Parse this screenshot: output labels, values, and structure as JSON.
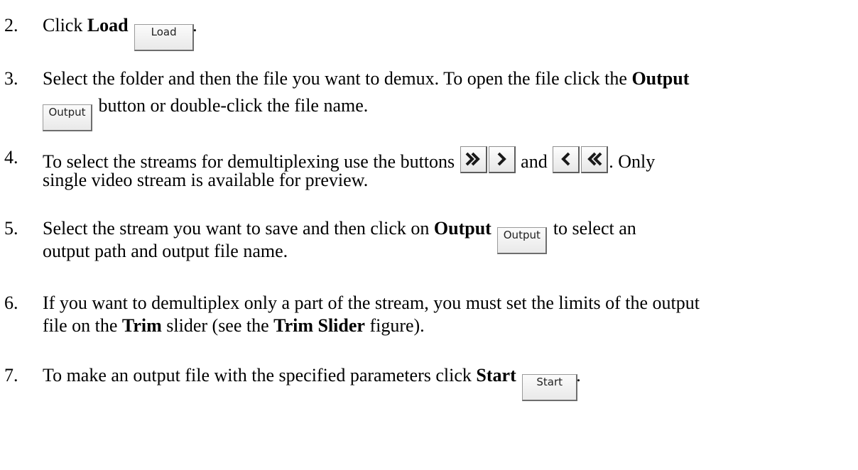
{
  "steps": [
    {
      "number": "2.",
      "line1_pre": "Click ",
      "line1_bold": "Load",
      "button_label": "Load",
      "line1_post": "."
    },
    {
      "number": "3.",
      "line1_pre": "Select the folder and then the file you want to demux. To open the file click the ",
      "line1_bold": "Output",
      "button_label": "Output",
      "line2_post": " button or double-click the file name."
    },
    {
      "number": "4.",
      "line1_pre": "To select the streams for demultiplexing use the buttons ",
      "line1_mid": " and ",
      "line1_post": ". Only",
      "line2": "single video stream is available for preview.",
      "icons": [
        "double-right-arrow-icon",
        "right-arrow-icon",
        "left-arrow-icon",
        "double-left-arrow-icon"
      ]
    },
    {
      "number": "5.",
      "line1_pre": "Select the stream you want to save and then click on ",
      "line1_bold": "Output",
      "button_label": "Output",
      "line1_post": " to select an",
      "line2": "output path and output file name."
    },
    {
      "number": "6.",
      "line1": "If you want to demultiplex only a part of the stream, you must set the limits of the output",
      "line2_pre": "file on the ",
      "line2_bold1": "Trim",
      "line2_mid": " slider (see the ",
      "line2_bold2": "Trim Slider",
      "line2_post": " figure)."
    },
    {
      "number": "7.",
      "line1_pre": "To make an output file with the specified parameters click ",
      "line1_bold": "Start",
      "button_label": "Start",
      "line1_post": "."
    }
  ],
  "colors": {
    "arrow": "#1a1a1a",
    "button_border": "#6e6e6e",
    "button_bg": "#eeeeee"
  }
}
